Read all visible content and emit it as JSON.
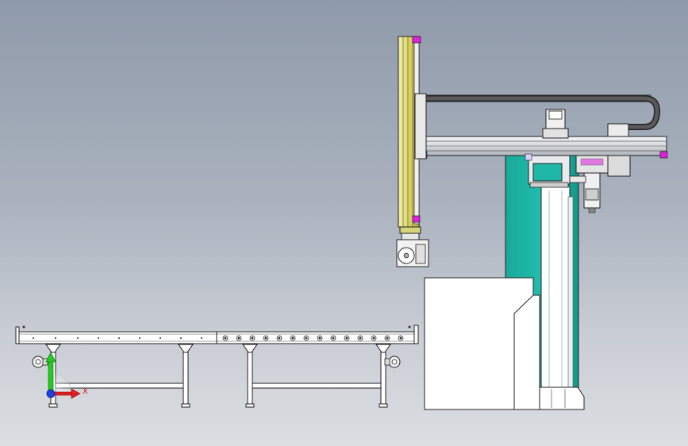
{
  "viewport": {
    "background_top": "#8f9aaa",
    "background_bottom": "#dcdee2"
  },
  "triad": {
    "x_label": "X",
    "x_color": "#e02020",
    "y_color": "#22cc22",
    "z_color": "#1f3fe0"
  },
  "colors": {
    "outline": "#1a1a1a",
    "mast_yellow": "#d8d47a",
    "column_teal": "#1fb8a8",
    "metal_light": "#e4e6ea",
    "metal_mid": "#c2c6cc",
    "marker_magenta": "#e020e0",
    "cable_chain": "#3a3a3a",
    "white_panel": "#ffffff"
  },
  "scene_parts": [
    "roller-conveyor",
    "vertical-mast",
    "horizontal-gantry-beam",
    "drag-chain",
    "teal-column",
    "base-cabinet",
    "gripper-head"
  ]
}
